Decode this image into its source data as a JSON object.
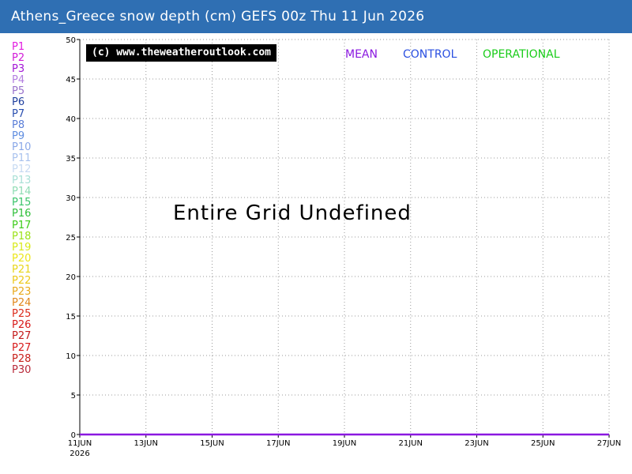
{
  "title": "Athens_Greece snow depth (cm) GEFS 00z Thu 11 Jun 2026",
  "copyright": "(c) www.theweatheroutlook.com",
  "message": "Entire Grid Undefined",
  "series_labels": [
    {
      "label": "MEAN",
      "color": "#8a18e0"
    },
    {
      "label": "CONTROL",
      "color": "#2a4fe0"
    },
    {
      "label": "OPERATIONAL",
      "color": "#19cc19"
    }
  ],
  "legend": [
    {
      "label": "P1",
      "color": "#e21ae0"
    },
    {
      "label": "P2",
      "color": "#d21ad8"
    },
    {
      "label": "P3",
      "color": "#a318d6"
    },
    {
      "label": "P4",
      "color": "#b37ee0"
    },
    {
      "label": "P5",
      "color": "#9a72cc"
    },
    {
      "label": "P6",
      "color": "#1f3f9e"
    },
    {
      "label": "P7",
      "color": "#2a4fb0"
    },
    {
      "label": "P8",
      "color": "#5a7ed8"
    },
    {
      "label": "P9",
      "color": "#5f8de0"
    },
    {
      "label": "P10",
      "color": "#8aa8e8"
    },
    {
      "label": "P11",
      "color": "#a9c2ee"
    },
    {
      "label": "P12",
      "color": "#c7daf2"
    },
    {
      "label": "P13",
      "color": "#a9e0d6"
    },
    {
      "label": "P14",
      "color": "#8fdcb4"
    },
    {
      "label": "P15",
      "color": "#3ac46a"
    },
    {
      "label": "P16",
      "color": "#2fbf3a"
    },
    {
      "label": "P17",
      "color": "#3dcc1a"
    },
    {
      "label": "P18",
      "color": "#9ce21a"
    },
    {
      "label": "P19",
      "color": "#d8ea1a"
    },
    {
      "label": "P20",
      "color": "#ece61a"
    },
    {
      "label": "P21",
      "color": "#e8d61a"
    },
    {
      "label": "P22",
      "color": "#ecc81a"
    },
    {
      "label": "P23",
      "color": "#e8a81a"
    },
    {
      "label": "P24",
      "color": "#e0861a"
    },
    {
      "label": "P25",
      "color": "#dc2a1a"
    },
    {
      "label": "P26",
      "color": "#d81a1a"
    },
    {
      "label": "P27",
      "color": "#c41a1a"
    },
    {
      "label": "P27",
      "color": "#d81a1a"
    },
    {
      "label": "P28",
      "color": "#c8201a"
    },
    {
      "label": "P30",
      "color": "#b82a3a"
    }
  ],
  "chart_data": {
    "type": "line",
    "title": "Athens_Greece snow depth (cm) GEFS 00z Thu 11 Jun 2026",
    "xlabel": "",
    "ylabel": "",
    "ylim": [
      0,
      50
    ],
    "yticks": [
      0,
      5,
      10,
      15,
      20,
      25,
      30,
      35,
      40,
      45,
      50
    ],
    "xlim": [
      "2026-06-11",
      "2026-06-27"
    ],
    "xticks": [
      {
        "date": "2026-06-11",
        "label": "11JUN",
        "sublabel": "2026"
      },
      {
        "date": "2026-06-13",
        "label": "13JUN"
      },
      {
        "date": "2026-06-15",
        "label": "15JUN"
      },
      {
        "date": "2026-06-17",
        "label": "17JUN"
      },
      {
        "date": "2026-06-19",
        "label": "19JUN"
      },
      {
        "date": "2026-06-21",
        "label": "21JUN"
      },
      {
        "date": "2026-06-23",
        "label": "23JUN"
      },
      {
        "date": "2026-06-25",
        "label": "25JUN"
      },
      {
        "date": "2026-06-27",
        "label": "27JUN"
      }
    ],
    "grid": true,
    "series": [
      {
        "name": "MEAN",
        "color": "#8a18e0",
        "x": [
          "2026-06-11",
          "2026-06-27"
        ],
        "values": [
          0,
          0
        ]
      }
    ]
  }
}
